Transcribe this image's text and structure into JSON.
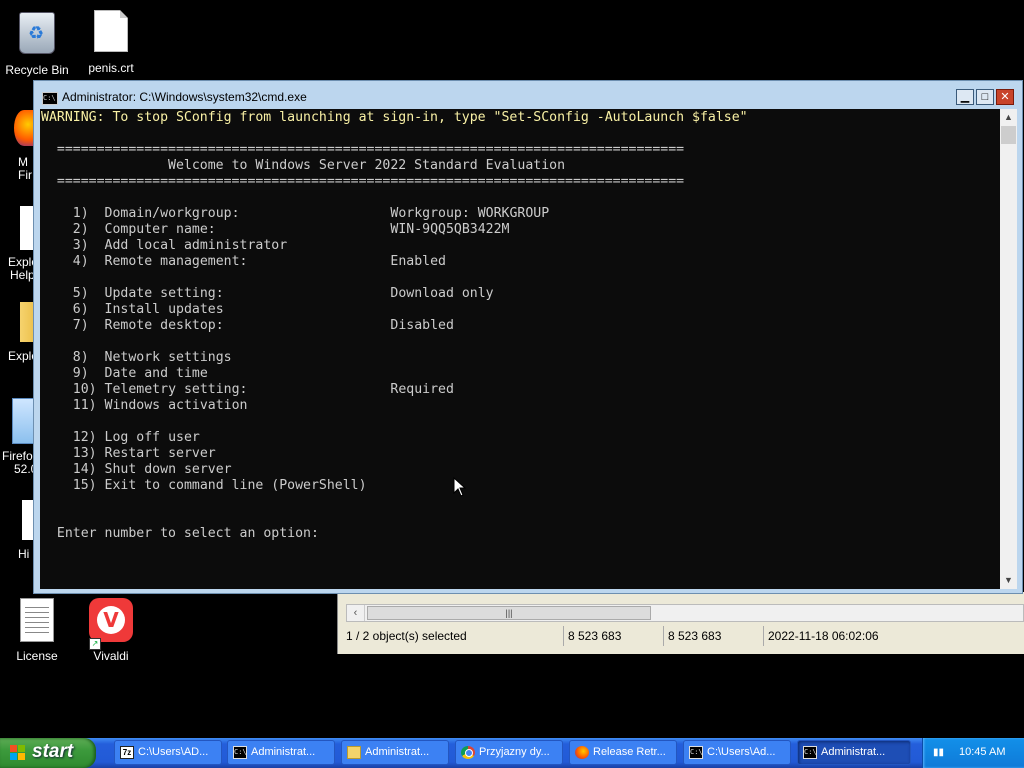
{
  "desktop": {
    "icons": [
      {
        "label": "Recycle Bin"
      },
      {
        "label": "penis.crt"
      },
      {
        "label": "License"
      },
      {
        "label": "Vivaldi"
      }
    ],
    "partial_labels": {
      "mf_line1": "M",
      "mf_line2": "Fir",
      "explorer_help_1": "Explo",
      "explorer_help_2": "Help",
      "explorer": "Explo",
      "firefox_1": "Firefo",
      "firefox_2": "52.0",
      "hi": "Hi"
    }
  },
  "cmd": {
    "title": "Administrator: C:\\Windows\\system32\\cmd.exe",
    "buttons": {
      "minimize": "▁",
      "maximize": "□",
      "close": "✕"
    },
    "warning": "WARNING: To stop SConfig from launching at sign-in, type \"Set-SConfig -AutoLaunch $false\"",
    "separator": "===============================================================================",
    "welcome": "Welcome to Windows Server 2022 Standard Evaluation",
    "menu": [
      {
        "num": "1)",
        "label": "Domain/workgroup:",
        "value": "Workgroup: WORKGROUP"
      },
      {
        "num": "2)",
        "label": "Computer name:",
        "value": "WIN-9QQ5QB3422M"
      },
      {
        "num": "3)",
        "label": "Add local administrator",
        "value": ""
      },
      {
        "num": "4)",
        "label": "Remote management:",
        "value": "Enabled"
      },
      {
        "num": "5)",
        "label": "Update setting:",
        "value": "Download only"
      },
      {
        "num": "6)",
        "label": "Install updates",
        "value": ""
      },
      {
        "num": "7)",
        "label": "Remote desktop:",
        "value": "Disabled"
      },
      {
        "num": "8)",
        "label": "Network settings",
        "value": ""
      },
      {
        "num": "9)",
        "label": "Date and time",
        "value": ""
      },
      {
        "num": "10)",
        "label": "Telemetry setting:",
        "value": "Required"
      },
      {
        "num": "11)",
        "label": "Windows activation",
        "value": ""
      },
      {
        "num": "12)",
        "label": "Log off user",
        "value": ""
      },
      {
        "num": "13)",
        "label": "Restart server",
        "value": ""
      },
      {
        "num": "14)",
        "label": "Shut down server",
        "value": ""
      },
      {
        "num": "15)",
        "label": "Exit to command line (PowerShell)",
        "value": ""
      }
    ],
    "prompt": "Enter number to select an option:"
  },
  "explorer": {
    "status": {
      "selection": "1 / 2 object(s) selected",
      "size1": "8 523 683",
      "size2": "8 523 683",
      "date": "2022-11-18 06:02:06"
    }
  },
  "taskbar": {
    "start_label": "start",
    "tasks": [
      {
        "label": "C:\\Users\\AD...",
        "icon": "zz-icon"
      },
      {
        "label": "Administrat...",
        "icon": "cmd-icon"
      },
      {
        "label": "Administrat...",
        "icon": "folder-icon"
      },
      {
        "label": "Przyjazny dy...",
        "icon": "chrome-icon"
      },
      {
        "label": "Release Retr...",
        "icon": "firefox-icon"
      },
      {
        "label": "C:\\Users\\Ad...",
        "icon": "cmd-icon"
      },
      {
        "label": "Administrat...",
        "icon": "cmd-icon"
      }
    ],
    "clock": "10:45 AM"
  },
  "colors": {
    "console_bg": "#0c0c0c",
    "console_text": "#cccccc",
    "warning_text": "#f9f1a5",
    "taskbar_blue": "#245edb",
    "start_green": "#3c9a3c"
  }
}
